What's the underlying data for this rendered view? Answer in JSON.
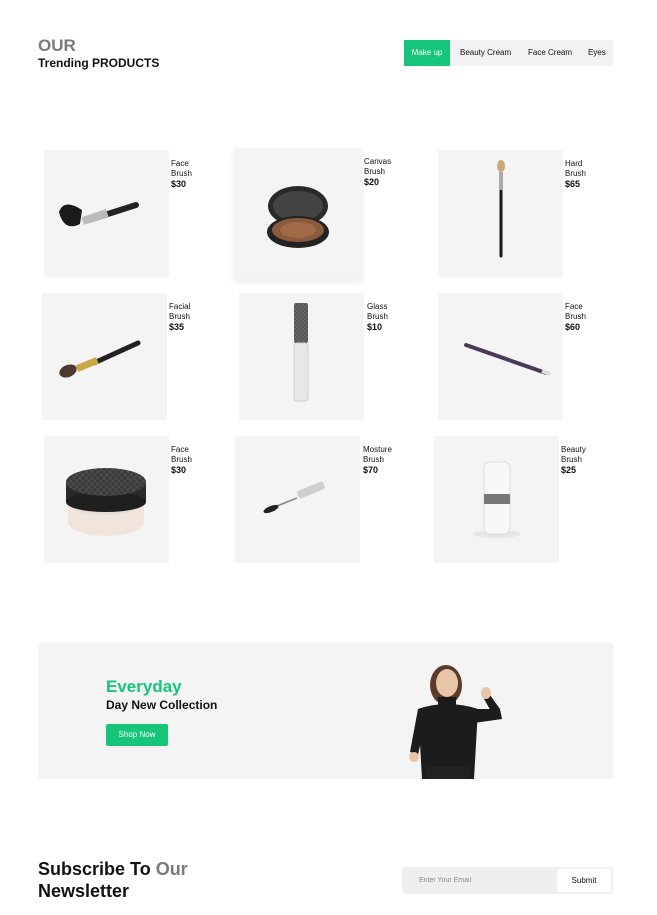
{
  "header": {
    "our": "OUR",
    "trending": "Trending PRODUCTS"
  },
  "tabs": [
    {
      "label": "Make up",
      "active": true
    },
    {
      "label": "Beauty Cream",
      "active": false
    },
    {
      "label": "Face Cream",
      "active": false
    },
    {
      "label": "Eyes",
      "active": false
    }
  ],
  "products": [
    {
      "name": "Face Brush",
      "price": "$30",
      "icon": "face-brush"
    },
    {
      "name": "Canvas Brush",
      "price": "$20",
      "icon": "compact-powder"
    },
    {
      "name": "Hard Brush",
      "price": "$65",
      "icon": "eyeshadow-brush"
    },
    {
      "name": "Facial Brush",
      "price": "$35",
      "icon": "facial-brush"
    },
    {
      "name": "Glass Brush",
      "price": "$10",
      "icon": "lip-gloss-tube"
    },
    {
      "name": "Face Brush",
      "price": "$60",
      "icon": "eye-pencil"
    },
    {
      "name": "Face Brush",
      "price": "$30",
      "icon": "loose-powder-jar"
    },
    {
      "name": "Mosture Brush",
      "price": "$70",
      "icon": "mascara-wand"
    },
    {
      "name": "Beauty Brush",
      "price": "$25",
      "icon": "white-bottle"
    }
  ],
  "banner": {
    "title": "Everyday",
    "subtitle": "Day New Collection",
    "button": "Shop Now"
  },
  "newsletter": {
    "title_part1": "Subscribe To ",
    "title_accent": "Our",
    "title_part2": "Newsletter",
    "placeholder": "Enter Your Email",
    "submit": "Submit"
  },
  "colors": {
    "accent": "#16c47a",
    "muted": "#7a7a7a",
    "card": "#f4f4f4"
  }
}
